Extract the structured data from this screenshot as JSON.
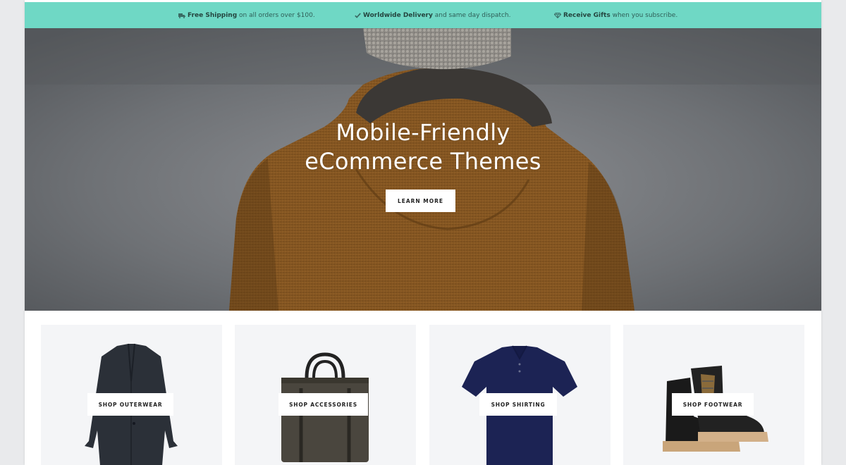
{
  "promo_bar": {
    "items": [
      {
        "icon": "truck-icon",
        "bold": "Free Shipping",
        "text": " on all orders over $100."
      },
      {
        "icon": "check-icon",
        "bold": "Worldwide Delivery",
        "text": " and same day dispatch."
      },
      {
        "icon": "diamond-icon",
        "bold": "Receive Gifts",
        "text": " when you subscribe."
      }
    ],
    "background_color": "#6fd8c5"
  },
  "hero": {
    "title_line1": "Mobile-Friendly",
    "title_line2": "eCommerce Themes",
    "button_label": "LEARN MORE"
  },
  "categories": [
    {
      "label": "SHOP OUTERWEAR",
      "image": "coat-image"
    },
    {
      "label": "SHOP ACCESSORIES",
      "image": "bag-image"
    },
    {
      "label": "SHOP SHIRTING",
      "image": "polo-shirt-image"
    },
    {
      "label": "SHOP FOOTWEAR",
      "image": "boots-image"
    }
  ]
}
